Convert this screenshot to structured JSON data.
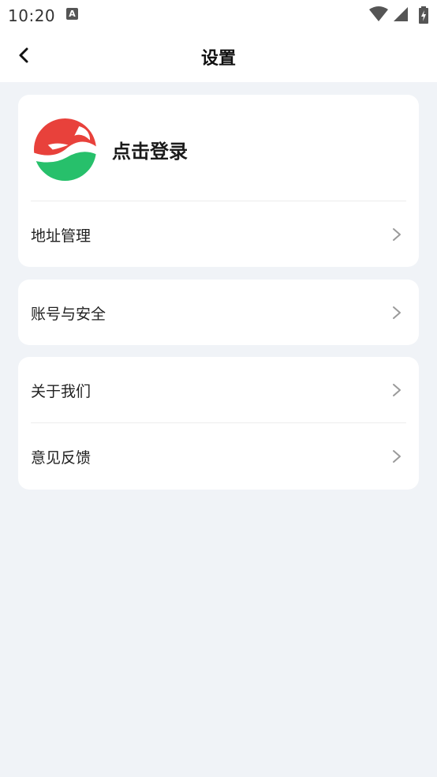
{
  "status": {
    "time": "10:20",
    "notification_badge": "A"
  },
  "nav": {
    "title": "设置"
  },
  "profile": {
    "login_label": "点击登录"
  },
  "groups": [
    {
      "items": [
        {
          "label": "地址管理"
        }
      ]
    },
    {
      "items": [
        {
          "label": "账号与安全"
        }
      ]
    },
    {
      "items": [
        {
          "label": "关于我们"
        },
        {
          "label": "意见反馈"
        }
      ]
    }
  ],
  "colors": {
    "background": "#f0f3f7",
    "card": "#ffffff",
    "logo_red": "#e8413b",
    "logo_green": "#27c06b"
  }
}
